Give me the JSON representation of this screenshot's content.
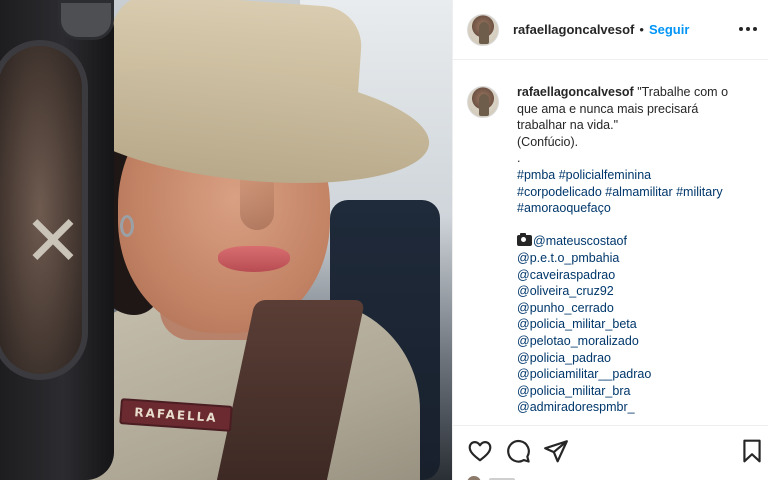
{
  "post": {
    "username": "rafaellagoncalvesof",
    "separator": "•",
    "follow_label": "Seguir",
    "badge_text": "RAFAELLA"
  },
  "caption": {
    "username": "rafaellagoncalvesof",
    "quote_line1": "\"Trabalhe com o",
    "quote_line2": "que ama e nunca mais precisará",
    "quote_line3": "trabalhar na vida.\"",
    "author": "(Confúcio).",
    "dot": ".",
    "hashtags_line1": "#pmba #policialfeminina",
    "hashtags_line2": "#corpodelicado #almamilitar #military",
    "hashtags_line3": "#amoraoquefaço",
    "mentions": [
      "@mateuscostaof",
      "@p.e.t.o_pmbahia",
      "@caveiraspadrao",
      "@oliveira_cruz92",
      "@punho_cerrado",
      "@policia_militar_beta",
      "@pelotao_moralizado",
      "@policia_padrao",
      "@policiamilitar__padrao",
      "@policia_militar_bra",
      "@admiradorespmbr_"
    ]
  },
  "icons": {
    "more": "more-options-icon",
    "like": "heart-icon",
    "comment": "comment-icon",
    "share": "paper-plane-icon",
    "save": "bookmark-icon",
    "camera": "camera-icon"
  },
  "colors": {
    "link": "#00376b",
    "follow": "#0095f6",
    "text": "#262626",
    "border": "#efefef"
  }
}
